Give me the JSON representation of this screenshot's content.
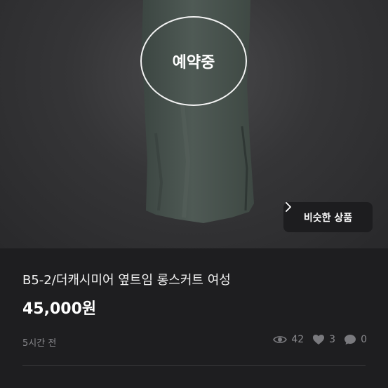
{
  "product": {
    "status_badge": "예약중",
    "similar_button_label": "비슷한 상품",
    "title": "B5-2/더캐시미어 옆트임 롱스커트 여성",
    "price": "45,000원",
    "posted_time": "5시간 전",
    "stats": {
      "views": "42",
      "likes": "3",
      "chats": "0"
    }
  },
  "icons": {
    "views": "eye-icon",
    "likes": "heart-icon",
    "chats": "chat-bubble-icon",
    "similar": "chevron-right-icon"
  },
  "colors": {
    "background": "#1e1e20",
    "text_primary": "#ffffff",
    "text_muted": "#8a8a8e",
    "badge_border": "#f2f2f2"
  }
}
